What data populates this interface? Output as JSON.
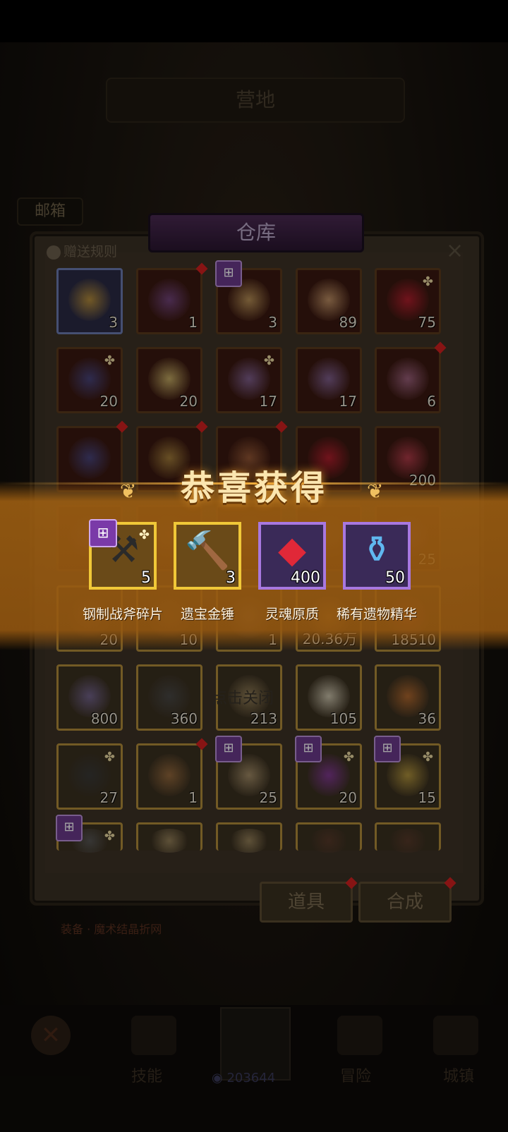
{
  "scene": {
    "camp_title": "营地",
    "mailbox_label": "邮箱"
  },
  "warehouse": {
    "tab_title": "仓库",
    "gift_rules": "赠送规则",
    "close_symbol": "×",
    "dismiss_hint": "点击关闭",
    "rows": [
      [
        {
          "count": "3",
          "frame": "blue",
          "art": "golden-mask"
        },
        {
          "count": "1",
          "frame": "red",
          "pip": true,
          "art": "purple-chest"
        },
        {
          "count": "3",
          "frame": "red",
          "gift": true,
          "art": "crown-chest"
        },
        {
          "count": "89",
          "frame": "red",
          "art": "feather"
        },
        {
          "count": "75",
          "frame": "red",
          "sparkle": true,
          "art": "red-gem"
        }
      ],
      [
        {
          "count": "20",
          "frame": "red",
          "sparkle": true,
          "art": "witch-hero"
        },
        {
          "count": "20",
          "frame": "red",
          "art": "masked-hero"
        },
        {
          "count": "17",
          "frame": "red",
          "sparkle": true,
          "art": "crystal-shard"
        },
        {
          "count": "17",
          "frame": "red",
          "art": "crystal-shard"
        },
        {
          "count": "6",
          "frame": "red",
          "pip": true,
          "art": "pink-chest"
        }
      ],
      [
        {
          "count": "",
          "frame": "red",
          "pip": true,
          "art": "witch-hero"
        },
        {
          "count": "",
          "frame": "red",
          "pip": true,
          "art": "spiky-hero"
        },
        {
          "count": "",
          "frame": "red",
          "pip": true,
          "art": "hero"
        },
        {
          "count": "",
          "frame": "red",
          "art": "red-gem"
        },
        {
          "count": "200",
          "frame": "red",
          "art": "amulet"
        }
      ],
      [
        {
          "count": "",
          "frame": "red",
          "art": "orb"
        },
        {
          "count": "",
          "frame": "red",
          "art": "item"
        },
        {
          "count": "",
          "frame": "red",
          "art": "item"
        },
        {
          "count": "",
          "frame": "red",
          "art": "item"
        },
        {
          "count": "25",
          "frame": "red",
          "art": "orb"
        }
      ],
      [
        {
          "count": "20",
          "frame": "gold",
          "art": "rune"
        },
        {
          "count": "10",
          "frame": "gold",
          "art": "rune"
        },
        {
          "count": "1",
          "frame": "gold",
          "art": "emblem"
        },
        {
          "count": "20.36万",
          "frame": "gold",
          "art": "coin"
        },
        {
          "count": "18510",
          "frame": "gold",
          "art": "rose"
        }
      ],
      [
        {
          "count": "800",
          "frame": "gold",
          "art": "purple-rune"
        },
        {
          "count": "360",
          "frame": "gold",
          "art": "book"
        },
        {
          "count": "213",
          "frame": "gold",
          "art": "scroll"
        },
        {
          "count": "105",
          "frame": "gold",
          "art": "candle"
        },
        {
          "count": "36",
          "frame": "gold",
          "art": "potion"
        }
      ],
      [
        {
          "count": "27",
          "frame": "gold",
          "sparkle": true,
          "art": "ore"
        },
        {
          "count": "1",
          "frame": "gold",
          "pip": true,
          "art": "mystery-chest"
        },
        {
          "count": "25",
          "frame": "gold",
          "gift": true,
          "art": "card"
        },
        {
          "count": "20",
          "frame": "gold",
          "gift": true,
          "sparkle": true,
          "art": "crystal"
        },
        {
          "count": "15",
          "frame": "gold",
          "gift": true,
          "sparkle": true,
          "art": "gold-pile"
        }
      ],
      [
        {
          "count": "",
          "frame": "gold",
          "gift": true,
          "sparkle": true,
          "art": "axe"
        },
        {
          "count": "",
          "frame": "gold",
          "art": "scroll"
        },
        {
          "count": "",
          "frame": "gold",
          "art": "scroll"
        },
        {
          "count": "",
          "frame": "gold",
          "art": "item"
        },
        {
          "count": "",
          "frame": "gold",
          "art": "item"
        }
      ]
    ],
    "tabs": [
      {
        "label": "道具",
        "pip": true
      },
      {
        "label": "合成",
        "pip": true
      }
    ],
    "below_text": "装备 · 魔术结晶折网"
  },
  "congrats": {
    "title": "恭喜获得",
    "rewards": [
      {
        "name": "钢制战斧碎片",
        "count": "5",
        "frame": "gold",
        "gift": true,
        "sparkle": true,
        "icon": "axe-icon"
      },
      {
        "name": "遗宝金锤",
        "count": "3",
        "frame": "gold",
        "icon": "hammer-icon"
      },
      {
        "name": "灵魂原质",
        "count": "400",
        "frame": "purple",
        "icon": "red-crystal-icon"
      },
      {
        "name": "稀有遗物精华",
        "count": "50",
        "frame": "purple",
        "icon": "potion-icon"
      }
    ]
  },
  "nav": {
    "items": [
      "技能",
      "冒险",
      "城镇"
    ],
    "center_count": "203644"
  },
  "colors": {
    "gold_frame": "#f0c838",
    "purple_frame": "#a878e0",
    "band": "#a06012",
    "title_text": "#fbe6b0"
  }
}
